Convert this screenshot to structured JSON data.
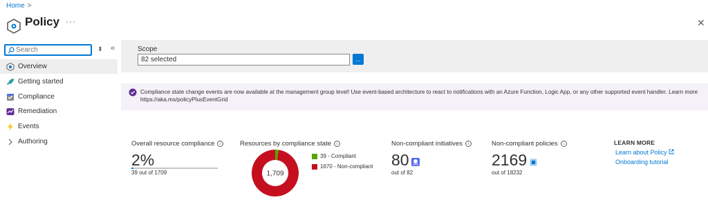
{
  "breadcrumb": {
    "home": "Home",
    "separator": ">"
  },
  "header": {
    "title": "Policy",
    "more": "···",
    "close": "✕"
  },
  "sidebar": {
    "search_placeholder": "Search",
    "items": [
      {
        "label": "Overview",
        "icon": "policy-overview-icon"
      },
      {
        "label": "Getting started",
        "icon": "rocket-icon"
      },
      {
        "label": "Compliance",
        "icon": "compliance-icon"
      },
      {
        "label": "Remediation",
        "icon": "remediation-icon"
      },
      {
        "label": "Events",
        "icon": "lightning-icon"
      },
      {
        "label": "Authoring",
        "icon": "chevron-right-icon"
      }
    ]
  },
  "scope": {
    "label": "Scope",
    "value": "82 selected",
    "button": "..."
  },
  "banner": {
    "text": "Compliance state change events are now available at the management group level! Use event-based architecture to react to notifications with an Azure Function, Logic App, or any other supported event handler. Learn more https://aka.ms/policyPlusEventGrid"
  },
  "metrics": {
    "overall": {
      "title": "Overall resource compliance",
      "value": "2%",
      "sub": "39 out of 1709",
      "fraction": 0.0228
    },
    "by_state": {
      "title": "Resources by compliance state",
      "center": "1,709",
      "legend": [
        {
          "label": "39 - Compliant",
          "color": "#57a300"
        },
        {
          "label": "1670 - Non-compliant",
          "color": "#c50f1f"
        }
      ]
    },
    "initiatives": {
      "title": "Non-compliant initiatives",
      "value": "80",
      "sub": "out of 82"
    },
    "policies": {
      "title": "Non-compliant policies",
      "value": "2169",
      "sub": "out of 18232"
    }
  },
  "learn_more": {
    "title": "LEARN MORE",
    "links": [
      "Learn about Policy",
      "Onboarding tutorial"
    ]
  },
  "chart_data": {
    "type": "pie",
    "categories": [
      "Compliant",
      "Non-compliant"
    ],
    "values": [
      39,
      1670
    ],
    "colors": [
      "#57a300",
      "#c50f1f"
    ]
  }
}
